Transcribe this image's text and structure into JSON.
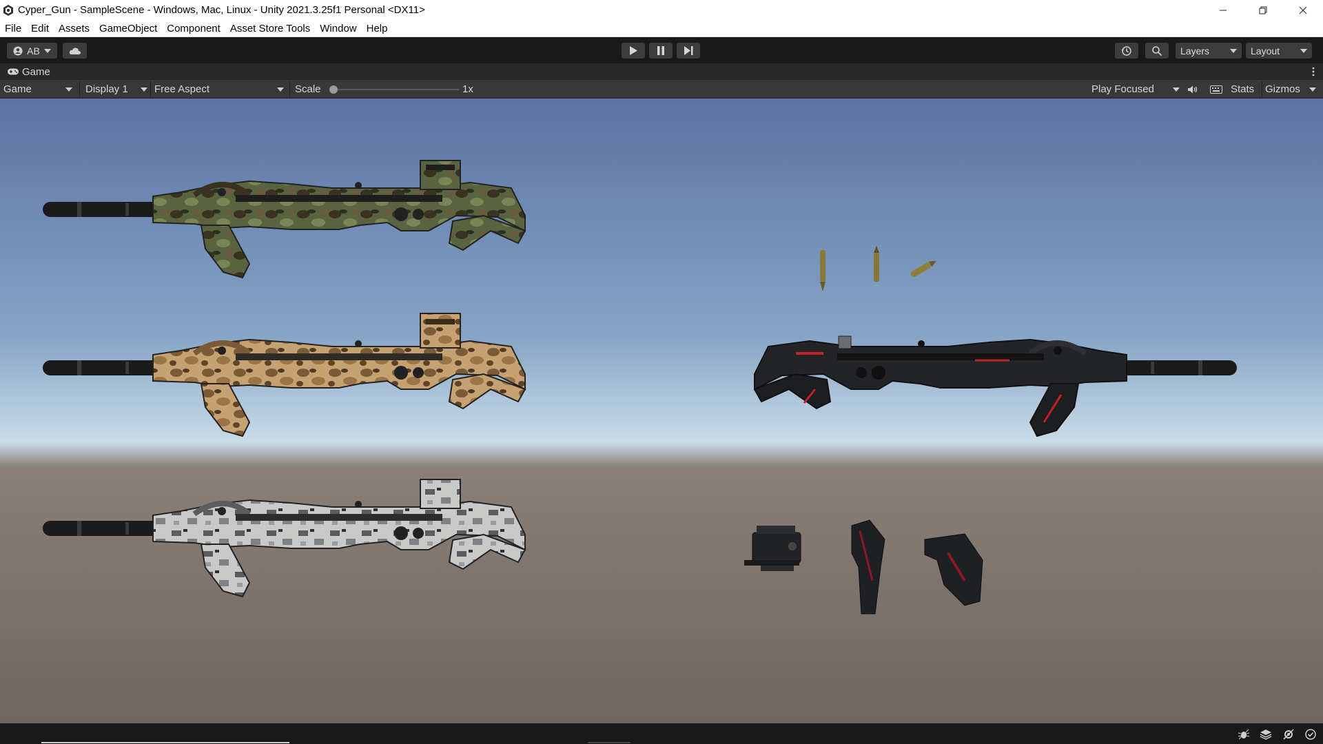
{
  "window": {
    "title": "Cyper_Gun - SampleScene - Windows, Mac, Linux - Unity 2021.3.25f1 Personal <DX11>",
    "controls": [
      "minimize",
      "restore",
      "close"
    ]
  },
  "menu": [
    "File",
    "Edit",
    "Assets",
    "GameObject",
    "Component",
    "Asset Store Tools",
    "Window",
    "Help"
  ],
  "toolbar": {
    "account_label": "AB",
    "cloud_icon": "cloud-icon",
    "play_icon": "play-icon",
    "pause_icon": "pause-icon",
    "step_icon": "step-icon",
    "history_icon": "history-icon",
    "search_icon": "search-icon",
    "layers_label": "Layers",
    "layout_label": "Layout"
  },
  "tab": {
    "label": "Game",
    "icon": "gamepad-icon"
  },
  "game_toolbar": {
    "view_select": "Game",
    "display_select": "Display 1",
    "aspect_select": "Free Aspect",
    "scale_label": "Scale",
    "scale_value": "1x",
    "scale_fraction": 0,
    "play_mode": "Play Focused",
    "stats_label": "Stats",
    "gizmos_label": "Gizmos"
  },
  "scene": {
    "sky_top": "#5a73a2",
    "sky_horizon": "#c9dce8",
    "ground": "#6e6660",
    "objects": [
      {
        "name": "rifle-green-camo",
        "color": "#4f5a36"
      },
      {
        "name": "rifle-desert-camo",
        "color": "#b08a5a"
      },
      {
        "name": "rifle-snow-camo",
        "color": "#a8aaa8"
      },
      {
        "name": "rifle-black-red",
        "color": "#1f2024",
        "accent": "#c0202a"
      },
      {
        "name": "bullet",
        "color": "#8a7a3a"
      },
      {
        "name": "scope-attachment",
        "color": "#222326"
      },
      {
        "name": "grip-attachment",
        "color": "#222326"
      },
      {
        "name": "stock-attachment",
        "color": "#222326"
      }
    ]
  },
  "statusbar_icons": [
    "debug-icon",
    "layers-stack-icon",
    "settings-off-icon",
    "checkmark-icon"
  ]
}
